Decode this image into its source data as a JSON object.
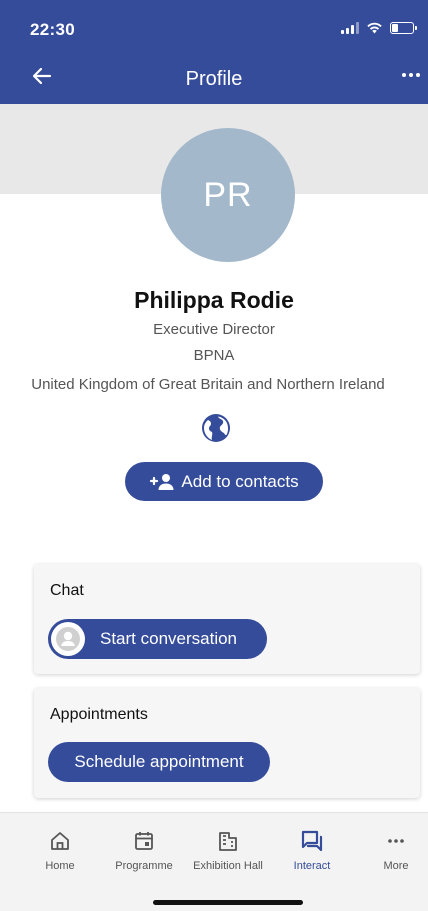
{
  "status_bar": {
    "time": "22:30"
  },
  "app_bar": {
    "title": "Profile"
  },
  "profile": {
    "initials": "PR",
    "name": "Philippa Rodie",
    "role": "Executive Director",
    "company": "BPNA",
    "country": "United Kingdom of Great Britain and Northern Ireland"
  },
  "actions": {
    "add_contact": "Add to contacts"
  },
  "chat_card": {
    "title": "Chat",
    "button": "Start conversation"
  },
  "appointments_card": {
    "title": "Appointments",
    "button": "Schedule appointment"
  },
  "bottom_nav": [
    {
      "label": "Home",
      "icon": "home-icon"
    },
    {
      "label": "Programme",
      "icon": "calendar-icon"
    },
    {
      "label": "Exhibition Hall",
      "icon": "building-icon"
    },
    {
      "label": "Interact",
      "icon": "chat-icon",
      "active": true
    },
    {
      "label": "More",
      "icon": "more-icon"
    }
  ],
  "colors": {
    "primary": "#354c9b",
    "avatar": "#a3b8ca",
    "header_band": "#e8e8e8",
    "nav_active": "#354c9b"
  },
  "battery_level": 0.3
}
